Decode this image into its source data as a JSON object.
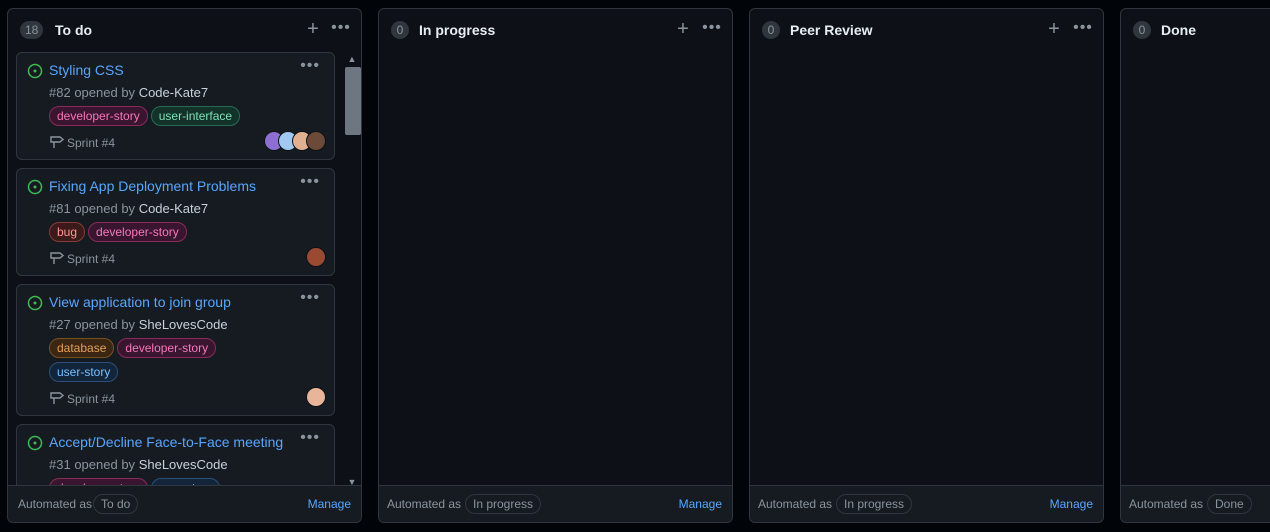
{
  "columns": [
    {
      "count": "18",
      "title": "To do",
      "automated_label": "Automated as",
      "automated_state": "To do",
      "manage_label": "Manage",
      "cards": [
        {
          "title": "Styling CSS",
          "number": "#82",
          "opened_by": "opened by",
          "author": "Code-Kate7",
          "labels": [
            {
              "text": "developer-story",
              "color": "#f778ba"
            },
            {
              "text": "user-interface",
              "color": "#7ee2b8"
            }
          ],
          "milestone": "Sprint #4",
          "avatars": [
            "#8c6fd1",
            "#a0c8f0",
            "#e0b090",
            "#6b4a3a"
          ]
        },
        {
          "title": "Fixing App Deployment Problems",
          "number": "#81",
          "opened_by": "opened by",
          "author": "Code-Kate7",
          "labels": [
            {
              "text": "bug",
              "color": "#f85149"
            },
            {
              "text": "developer-story",
              "color": "#f778ba"
            }
          ],
          "milestone": "Sprint #4",
          "avatars": [
            "#9a4a30"
          ]
        },
        {
          "title": "View application to join group",
          "number": "#27",
          "opened_by": "opened by",
          "author": "SheLovesCode",
          "labels": [
            {
              "text": "database",
              "color": "#e3a15a"
            },
            {
              "text": "developer-story",
              "color": "#f778ba"
            },
            {
              "text": "user-story",
              "color": "#79c0ff"
            }
          ],
          "milestone": "Sprint #4",
          "avatars": [
            "#e8b49a"
          ]
        },
        {
          "title": "Accept/Decline Face-to-Face meeting",
          "number": "#31",
          "opened_by": "opened by",
          "author": "SheLovesCode",
          "labels": [
            {
              "text": "developer-story",
              "color": "#f778ba"
            },
            {
              "text": "user-story",
              "color": "#79c0ff"
            }
          ],
          "milestone": "",
          "avatars": []
        }
      ]
    },
    {
      "count": "0",
      "title": "In progress",
      "automated_label": "Automated as",
      "automated_state": "In progress",
      "manage_label": "Manage"
    },
    {
      "count": "0",
      "title": "Peer Review",
      "automated_label": "Automated as",
      "automated_state": "In progress",
      "manage_label": "Manage"
    },
    {
      "count": "0",
      "title": "Done",
      "automated_label": "Automated as",
      "automated_state": "Done",
      "manage_label": ""
    }
  ],
  "icons": {
    "add": "plus-icon",
    "more": "kebab-horizontal-icon",
    "issue": "issue-opened-icon",
    "milestone": "milestone-icon",
    "scroll_up": "chevron-up-icon",
    "scroll_down": "chevron-down-icon"
  },
  "colors": {
    "background": "#010409",
    "column_bg": "#0d1117",
    "card_bg": "#161b22",
    "border": "#30363d",
    "link": "#58a6ff",
    "open_issue": "#3fb950"
  }
}
